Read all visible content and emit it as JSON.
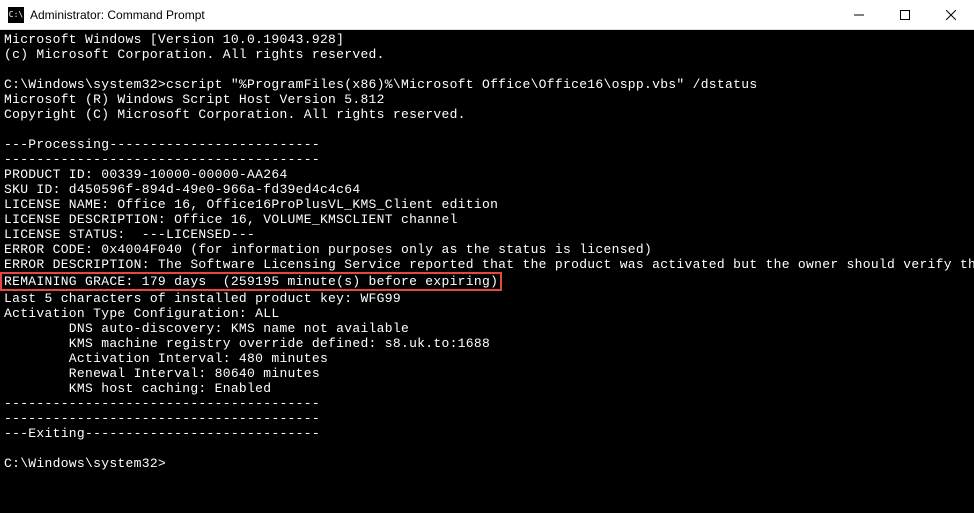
{
  "titlebar": {
    "icon_label": "C:\\",
    "title": "Administrator: Command Prompt"
  },
  "terminal": {
    "lines": [
      "Microsoft Windows [Version 10.0.19043.928]",
      "(c) Microsoft Corporation. All rights reserved.",
      "",
      "C:\\Windows\\system32>cscript \"%ProgramFiles(x86)%\\Microsoft Office\\Office16\\ospp.vbs\" /dstatus",
      "Microsoft (R) Windows Script Host Version 5.812",
      "Copyright (C) Microsoft Corporation. All rights reserved.",
      "",
      "---Processing--------------------------",
      "---------------------------------------",
      "PRODUCT ID: 00339-10000-00000-AA264",
      "SKU ID: d450596f-894d-49e0-966a-fd39ed4c4c64",
      "LICENSE NAME: Office 16, Office16ProPlusVL_KMS_Client edition",
      "LICENSE DESCRIPTION: Office 16, VOLUME_KMSCLIENT channel",
      "LICENSE STATUS:  ---LICENSED---",
      "ERROR CODE: 0x4004F040 (for information purposes only as the status is licensed)",
      "ERROR DESCRIPTION: The Software Licensing Service reported that the product was activated but the owner should verify the Product Use Rights.",
      "REMAINING GRACE: 179 days  (259195 minute(s) before expiring)",
      "Last 5 characters of installed product key: WFG99",
      "Activation Type Configuration: ALL",
      "        DNS auto-discovery: KMS name not available",
      "        KMS machine registry override defined: s8.uk.to:1688",
      "        Activation Interval: 480 minutes",
      "        Renewal Interval: 80640 minutes",
      "        KMS host caching: Enabled",
      "---------------------------------------",
      "---------------------------------------",
      "---Exiting-----------------------------",
      "",
      "C:\\Windows\\system32>"
    ],
    "highlight_index": 16
  }
}
